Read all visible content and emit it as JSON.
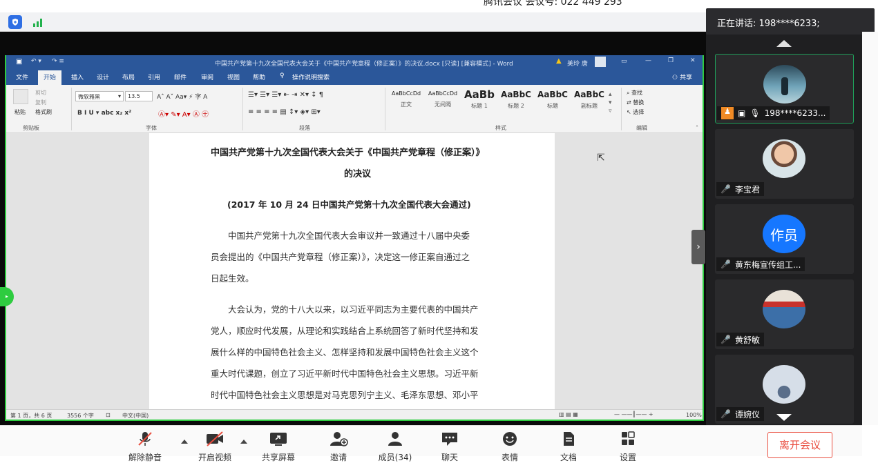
{
  "meeting": {
    "title": "腾讯会议  会议号: 022 449 293"
  },
  "speaking": {
    "label": "正在讲话: 198****6233;"
  },
  "word": {
    "title": "中国共产党第十九次全国代表大会关于《中国共产党章程（修正案）》的决议.docx [只读] [兼容模式] - Word",
    "user": "美玲 唐",
    "share_label": "共享",
    "tabs": [
      "文件",
      "开始",
      "插入",
      "设计",
      "布局",
      "引用",
      "邮件",
      "审阅",
      "视图",
      "帮助",
      "操作说明搜索"
    ],
    "ribbon": {
      "clipboard": {
        "paste": "粘贴",
        "cut": "剪切",
        "copy": "复制",
        "format_painter": "格式刷",
        "label": "剪贴板"
      },
      "font": {
        "name": "微软雅黑",
        "size": "13.5",
        "label": "字体"
      },
      "paragraph": {
        "label": "段落"
      },
      "styles": {
        "label": "样式",
        "items": [
          {
            "sample": "AaBbCcDd",
            "name": "正文"
          },
          {
            "sample": "AaBbCcDd",
            "name": "无间隔"
          },
          {
            "sample": "AaBb",
            "name": "标题 1"
          },
          {
            "sample": "AaBbC",
            "name": "标题 2"
          },
          {
            "sample": "AaBbC",
            "name": "标题"
          },
          {
            "sample": "AaBbC",
            "name": "副标题"
          }
        ]
      },
      "editing": {
        "find": "查找",
        "replace": "替换",
        "select": "选择",
        "label": "编辑"
      }
    },
    "doc": {
      "title1": "中国共产党第十九次全国代表大会关于《中国共产党章程（修正案）》",
      "title2": "的决议",
      "subtitle": "(2017 年 10 月 24 日中国共产党第十九次全国代表大会通过)",
      "lines": [
        "中国共产党第十九次全国代表大会审议并一致通过十八届中央委",
        "员会提出的《中国共产党章程（修正案）》，决定这一修正案自通过之",
        "日起生效。",
        "大会认为，党的十八大以来，以习近平同志为主要代表的中国共产",
        "党人，顺应时代发展，从理论和实践结合上系统回答了新时代坚持和发",
        "展什么样的中国特色社会主义、怎样坚持和发展中国特色社会主义这个",
        "重大时代课题，创立了习近平新时代中国特色社会主义思想。习近平新",
        "时代中国特色社会主义思想是对马克思列宁主义、毛泽东思想、邓小平"
      ]
    },
    "status": {
      "page": "第 1 页，共 6 页",
      "words": "3556 个字",
      "lang": "中文(中国)",
      "zoom": "100%"
    }
  },
  "participants": [
    {
      "name": "198****6233...",
      "avatar": "photo-landscape",
      "active": true
    },
    {
      "name": "李宝君",
      "avatar": "photo-man"
    },
    {
      "name": "黄东梅宣传组工...",
      "avatar": "text",
      "avatar_text": "作员",
      "avatar_color": "#1677ff"
    },
    {
      "name": "黄舒敏",
      "avatar": "photo-court"
    },
    {
      "name": "谭婉仪",
      "avatar": "photo-child"
    }
  ],
  "bottom": {
    "mute": "解除静音",
    "video": "开启视频",
    "share": "共享屏幕",
    "invite": "邀请",
    "members": "成员(34)",
    "chat": "聊天",
    "emoji": "表情",
    "docs": "文档",
    "settings": "设置",
    "leave": "离开会议"
  },
  "colors": {
    "word_blue": "#2b579a",
    "active_green": "#2ecc40",
    "leave_red": "#e94b3c",
    "avatar_blue": "#1677ff"
  }
}
